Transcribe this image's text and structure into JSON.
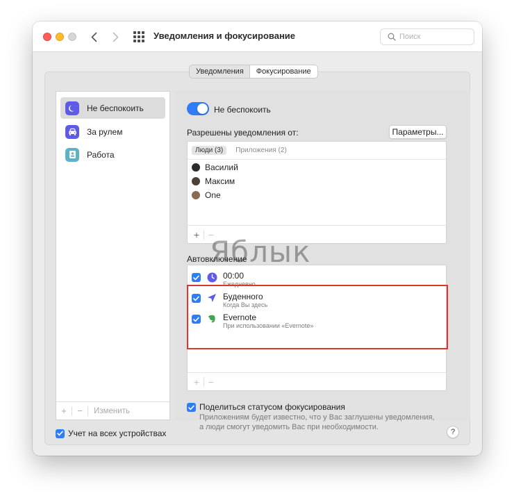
{
  "window": {
    "title": "Уведомления и фокусирование"
  },
  "search": {
    "placeholder": "Поиск"
  },
  "tabs": [
    {
      "label": "Уведомления",
      "active": false
    },
    {
      "label": "Фокусирование",
      "active": true
    }
  ],
  "sidebar": {
    "items": [
      {
        "label": "Не беспокоить",
        "icon": "moon-icon",
        "color": "#5e5ce6",
        "selected": true
      },
      {
        "label": "За рулем",
        "icon": "car-icon",
        "color": "#5e5ce6",
        "selected": false
      },
      {
        "label": "Работа",
        "icon": "badge-icon",
        "color": "#5fb2c4",
        "selected": false
      }
    ],
    "footer": {
      "add": "+",
      "remove": "−",
      "edit": "Изменить"
    }
  },
  "main": {
    "toggle": {
      "label": "Не беспокоить",
      "on": true
    },
    "allowed": {
      "label": "Разрешены уведомления от:",
      "options_button": "Параметры...",
      "subtabs": [
        {
          "label": "Люди (3)",
          "active": true
        },
        {
          "label": "Приложения (2)",
          "active": false
        }
      ],
      "people": [
        {
          "name": "Василий",
          "avatar_color": "#2b2b2b"
        },
        {
          "name": "Максим",
          "avatar_color": "#4a4038"
        },
        {
          "name": "One",
          "avatar_color": "#8a6a50"
        }
      ],
      "add": "+",
      "remove": "−"
    },
    "auto": {
      "label": "Автовключение",
      "items": [
        {
          "title": "00:00",
          "subtitle": "Ежедневно",
          "icon": "clock-icon",
          "checked": true
        },
        {
          "title": "Буденного",
          "subtitle": "Когда Вы здесь",
          "icon": "location-arrow-icon",
          "checked": true
        },
        {
          "title": "Evernote",
          "subtitle": "При использовании «Evernote»",
          "icon": "evernote-icon",
          "checked": true
        }
      ],
      "add": "+",
      "remove": "−"
    },
    "share": {
      "title": "Поделиться статусом фокусирования",
      "description": "Приложениям будет известно, что у Вас заглушены уведомления, а люди смогут уведомить Вас при необходимости.",
      "checked": true
    }
  },
  "footer": {
    "sync_label": "Учет на всех устройствах",
    "sync_checked": true,
    "help": "?"
  },
  "watermark": "Яблык",
  "colors": {
    "accent": "#2e7cf6",
    "highlight_border": "#e0342e"
  }
}
